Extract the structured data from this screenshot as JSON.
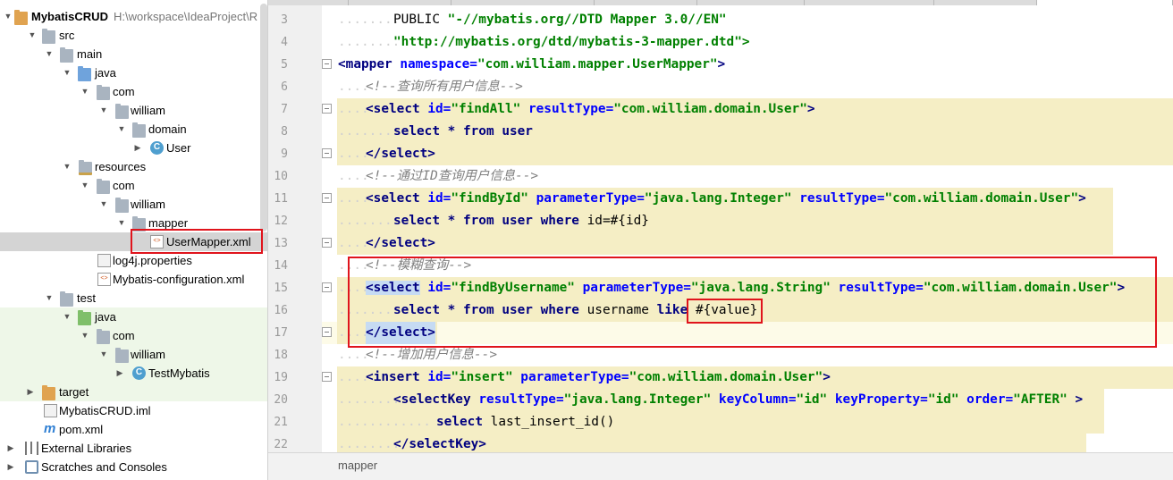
{
  "project": {
    "root_name": "MybatisCRUD",
    "root_path": "H:\\workspace\\IdeaProject\\R",
    "items": [
      {
        "label": "src"
      },
      {
        "label": "main"
      },
      {
        "label": "java"
      },
      {
        "label": "com"
      },
      {
        "label": "william"
      },
      {
        "label": "domain"
      },
      {
        "label": "User"
      },
      {
        "label": "resources"
      },
      {
        "label": "com"
      },
      {
        "label": "william"
      },
      {
        "label": "mapper"
      },
      {
        "label": "UserMapper.xml"
      },
      {
        "label": "log4j.properties"
      },
      {
        "label": "Mybatis-configuration.xml"
      },
      {
        "label": "test"
      },
      {
        "label": "java"
      },
      {
        "label": "com"
      },
      {
        "label": "william"
      },
      {
        "label": "TestMybatis"
      },
      {
        "label": "target"
      },
      {
        "label": "MybatisCRUD.iml"
      },
      {
        "label": "pom.xml"
      },
      {
        "label": "External Libraries"
      },
      {
        "label": "Scratches and Consoles"
      }
    ],
    "class_icon_letter": "C",
    "xml_icon_text": "<>"
  },
  "editor": {
    "line_numbers": [
      "3",
      "4",
      "5",
      "6",
      "7",
      "8",
      "9",
      "10",
      "11",
      "12",
      "13",
      "14",
      "15",
      "16",
      "17",
      "18",
      "19",
      "20",
      "21",
      "22"
    ],
    "lines": {
      "l3a": "PUBLIC ",
      "l3b": "\"-//mybatis.org//DTD Mapper 3.0//EN\"",
      "l4": "\"http://mybatis.org/dtd/mybatis-3-mapper.dtd\">",
      "l5a": "<mapper ",
      "l5b": "namespace=",
      "l5c": "\"com.william.mapper.UserMapper\"",
      "l5d": ">",
      "l6": "<!--查询所有用户信息-->",
      "l7a": "<select ",
      "l7b": "id=",
      "l7c": "\"findAll\" ",
      "l7d": "resultType=",
      "l7e": "\"com.william.domain.User\"",
      "l7f": ">",
      "l8a": "select ",
      "l8b": "* ",
      "l8c": "from ",
      "l8d": "user",
      "l9": "</select>",
      "l10": "<!--通过ID查询用户信息-->",
      "l11a": "<select ",
      "l11b": "id=",
      "l11c": "\"findById\" ",
      "l11d": "parameterType=",
      "l11e": "\"java.lang.Integer\" ",
      "l11f": "resultType=",
      "l11g": "\"com.william.domain.User\"",
      "l11h": ">",
      "l12a": "select ",
      "l12b": "* ",
      "l12c": "from ",
      "l12d": "user ",
      "l12e": "where ",
      "l12f": "id=#{id}",
      "l13": "</select>",
      "l14": "<!--模糊查询-->",
      "l15a": "<select",
      "l15b": " id=",
      "l15c": "\"findByUsername\" ",
      "l15d": "parameterType=",
      "l15e": "\"java.lang.String\" ",
      "l15f": "resultType=",
      "l15g": "\"com.william.domain.User\"",
      "l15h": ">",
      "l16a": "select ",
      "l16b": "* ",
      "l16c": "from ",
      "l16d": "user ",
      "l16e": "where ",
      "l16f": "username ",
      "l16g": "like ",
      "l16h": "#{value}",
      "l17": "</select>",
      "l18": "<!--增加用户信息-->",
      "l19a": "<insert ",
      "l19b": "id=",
      "l19c": "\"insert\" ",
      "l19d": "parameterType=",
      "l19e": "\"com.william.domain.User\"",
      "l19f": ">",
      "l20a": "<selectKey ",
      "l20b": "resultType=",
      "l20c": "\"java.lang.Integer\" ",
      "l20d": "keyColumn=",
      "l20e": "\"id\" ",
      "l20f": "keyProperty=",
      "l20g": "\"id\" ",
      "l20h": "order=",
      "l20i": "\"AFTER\" ",
      "l20j": ">",
      "l21a": "select ",
      "l21b": "last_insert_id()",
      "l22": "</selectKey>"
    },
    "breadcrumb": "mapper"
  },
  "colors": {
    "highlight_red": "#e0141c",
    "tag_blue": "#000080",
    "attr_blue": "#0000ff",
    "value_green": "#008000",
    "comment_gray": "#808080",
    "injected_bg": "#f5eec5"
  }
}
